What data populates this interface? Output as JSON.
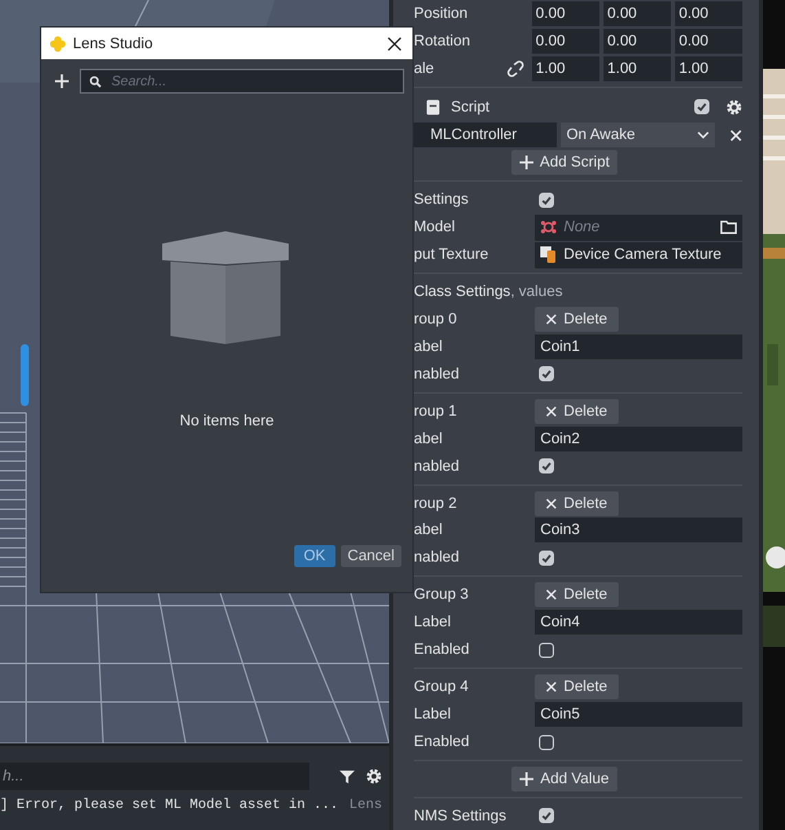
{
  "transform": [
    {
      "label": "Position",
      "values": [
        "0.00",
        "0.00",
        "0.00"
      ]
    },
    {
      "label": "Rotation",
      "values": [
        "0.00",
        "0.00",
        "0.00"
      ]
    },
    {
      "label": "ale",
      "values": [
        "1.00",
        "1.00",
        "1.00"
      ],
      "linked": true
    }
  ],
  "script": {
    "title": "Script",
    "enabled": true,
    "name": "MLController",
    "event": "On Awake",
    "add_button": "Add Script"
  },
  "properties": [
    {
      "label": "Settings",
      "kind": "checkbox",
      "checked": true
    },
    {
      "label": "Model",
      "kind": "asset",
      "value": "None",
      "empty": true
    },
    {
      "label": "put Texture",
      "kind": "asset",
      "value": "Device Camera Texture",
      "empty": false
    }
  ],
  "class_settings": {
    "title": "Class Settings",
    "suffix": ", values"
  },
  "groups": [
    {
      "title": "roup 0",
      "delete": "Delete",
      "label_caption": "abel",
      "label": "Coin1",
      "enabled_caption": "nabled",
      "enabled": true
    },
    {
      "title": "roup 1",
      "delete": "Delete",
      "label_caption": "abel",
      "label": "Coin2",
      "enabled_caption": "nabled",
      "enabled": true
    },
    {
      "title": "roup 2",
      "delete": "Delete",
      "label_caption": "abel",
      "label": "Coin3",
      "enabled_caption": "nabled",
      "enabled": true
    },
    {
      "title": "Group 3",
      "delete": "Delete",
      "label_caption": "Label",
      "label": "Coin4",
      "enabled_caption": "Enabled",
      "enabled": false
    },
    {
      "title": "Group 4",
      "delete": "Delete",
      "label_caption": "Label",
      "label": "Coin5",
      "enabled_caption": "Enabled",
      "enabled": false
    }
  ],
  "add_value": "Add Value",
  "nms": {
    "label": "NMS Settings",
    "checked": true
  },
  "console": {
    "search": {
      "placeholder": "h..."
    },
    "message": "] Error, please set ML Model asset in ...",
    "source": "Lens"
  },
  "dialog": {
    "title": "Lens Studio",
    "search": {
      "placeholder": "Search..."
    },
    "empty_text": "No items here",
    "buttons": [
      {
        "label": "OK",
        "kind": "primary"
      },
      {
        "label": "Cancel",
        "kind": "secondary"
      }
    ]
  }
}
